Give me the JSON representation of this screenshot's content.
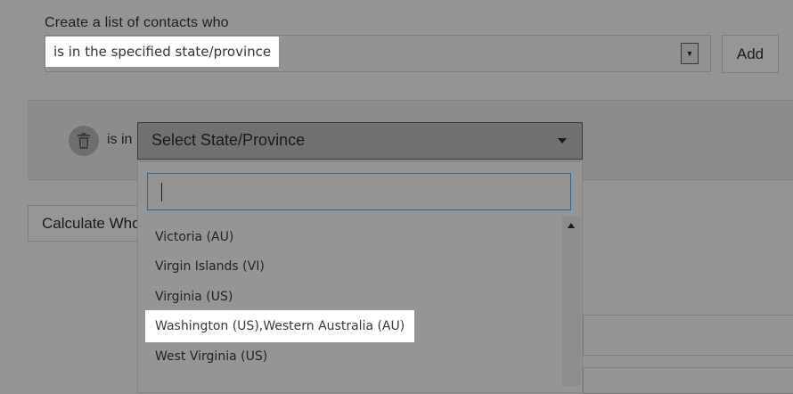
{
  "form": {
    "heading": "Create a list of contacts who",
    "criteria_select": {
      "value": "is in the specified state/province"
    },
    "add_button_label": "Add",
    "calculate_button_label": "Calculate Who"
  },
  "condition": {
    "operator_label": "is in",
    "state_select": {
      "placeholder": "Select State/Province"
    },
    "dropdown": {
      "search_value": "",
      "options": [
        "Victoria (AU)",
        "Virgin Islands (VI)",
        "Virginia (US)",
        "Washington (US),Western Australia (AU)",
        "West Virginia (US)"
      ],
      "highlighted_index": 3
    }
  },
  "icons": {
    "select_arrow": "triangle-down-icon",
    "trash": "trash-icon",
    "caret": "chevron-down-icon",
    "scroll_up": "scroll-up-icon"
  }
}
